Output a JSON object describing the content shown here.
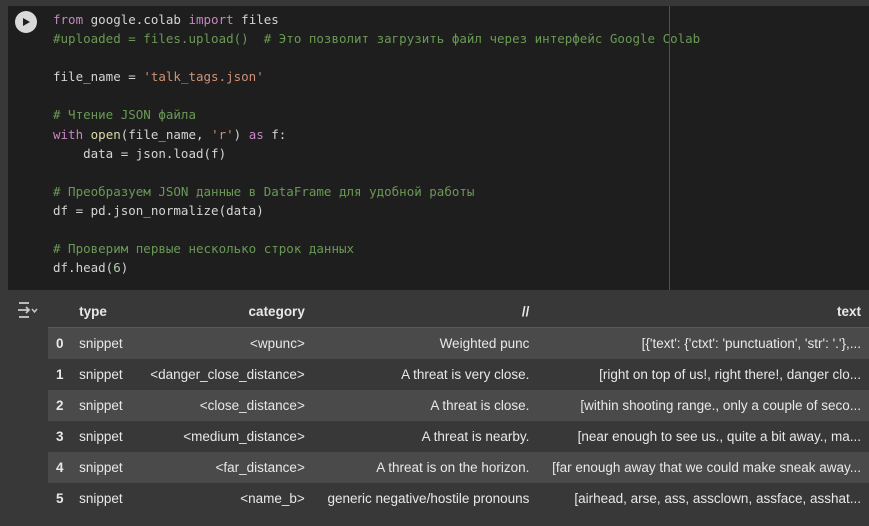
{
  "code_lines": [
    [
      {
        "t": "from ",
        "c": "kw"
      },
      {
        "t": "google.colab ",
        "c": ""
      },
      {
        "t": "import ",
        "c": "kw"
      },
      {
        "t": "files",
        "c": ""
      }
    ],
    [
      {
        "t": "#uploaded = files.upload()  # Это позволит загрузить файл через интерфейс Google Colab",
        "c": "cmt"
      }
    ],
    [],
    [
      {
        "t": "file_name = ",
        "c": ""
      },
      {
        "t": "'talk_tags.json'",
        "c": "str"
      }
    ],
    [],
    [
      {
        "t": "# Чтение JSON файла",
        "c": "cmt"
      }
    ],
    [
      {
        "t": "with ",
        "c": "kw"
      },
      {
        "t": "open",
        "c": "fn"
      },
      {
        "t": "(file_name, ",
        "c": ""
      },
      {
        "t": "'r'",
        "c": "str"
      },
      {
        "t": ") ",
        "c": ""
      },
      {
        "t": "as ",
        "c": "kw"
      },
      {
        "t": "f:",
        "c": ""
      }
    ],
    [
      {
        "t": "    data = json.load(f)",
        "c": ""
      }
    ],
    [],
    [
      {
        "t": "# Преобразуем JSON данные в DataFrame для удобной работы",
        "c": "cmt"
      }
    ],
    [
      {
        "t": "df = pd.json_normalize(data)",
        "c": ""
      }
    ],
    [],
    [
      {
        "t": "# Проверим первые несколько строк данных",
        "c": "cmt"
      }
    ],
    [
      {
        "t": "df.head(",
        "c": ""
      },
      {
        "t": "6",
        "c": "num"
      },
      {
        "t": ")",
        "c": ""
      }
    ]
  ],
  "table": {
    "columns": [
      "",
      "type",
      "category",
      "//",
      "text"
    ],
    "rows": [
      [
        "0",
        "snippet",
        "<wpunc>",
        "Weighted punc",
        "[{'text': {'ctxt': 'punctuation', 'str': '.'},..."
      ],
      [
        "1",
        "snippet",
        "<danger_close_distance>",
        "A threat is very close.",
        "[right on top of us!, right there!, danger clo..."
      ],
      [
        "2",
        "snippet",
        "<close_distance>",
        "A threat is close.",
        "[within shooting range., only a couple of seco..."
      ],
      [
        "3",
        "snippet",
        "<medium_distance>",
        "A threat is nearby.",
        "[near enough to see us., quite a bit away., ma..."
      ],
      [
        "4",
        "snippet",
        "<far_distance>",
        "A threat is on the horizon.",
        "[far enough away that we could make sneak away..."
      ],
      [
        "5",
        "snippet",
        "<name_b>",
        "generic negative/hostile pronouns",
        "[airhead, arse, ass, assclown, assface, asshat..."
      ]
    ]
  },
  "icons": {
    "run": "play-circle-icon",
    "output": "output-toggle-icon"
  }
}
